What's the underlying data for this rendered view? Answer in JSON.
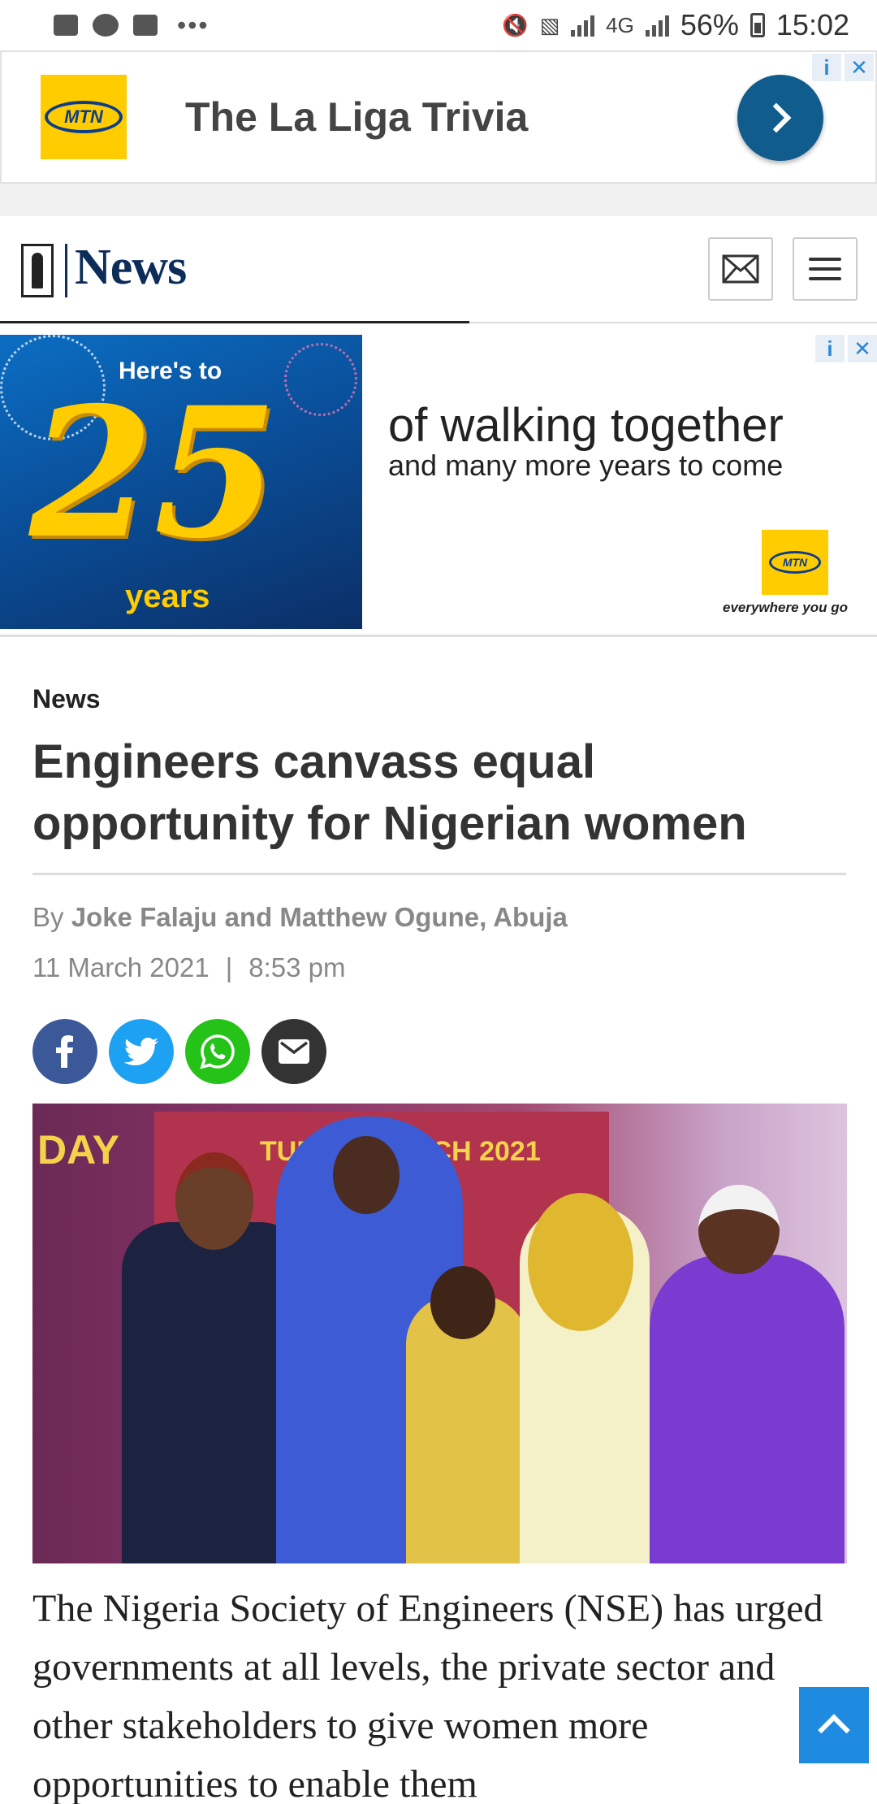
{
  "status_bar": {
    "battery": "56%",
    "time": "15:02",
    "network": "4G"
  },
  "top_ad": {
    "brand": "MTN",
    "title": "The La Liga Trivia"
  },
  "header": {
    "logo_text": "News"
  },
  "banner_ad": {
    "heres_to": "Here's to",
    "number": "25",
    "years": "years",
    "line1": "of walking together",
    "line2": "and many more years to come",
    "brand": "MTN",
    "tagline": "everywhere you go"
  },
  "article": {
    "category": "News",
    "headline": "Engineers canvass equal opportunity for Nigerian women",
    "by_prefix": "By",
    "authors": "Joke Falaju and Matthew Ogune, Abuja",
    "date": "11 March 2021",
    "separator": "|",
    "time": "8:53 pm",
    "photo_banner_text": "TUES    H MARCH 2021",
    "photo_day_text": "DAY",
    "body": "The Nigeria Society of Engineers (NSE) has urged governments at all levels, the private sector and other stakeholders to give women more opportunities to enable them"
  },
  "share": {
    "facebook": "f",
    "twitter": "t",
    "whatsapp": "w",
    "email": "e"
  },
  "colors": {
    "brand_navy": "#0c2d5a",
    "mtn_yellow": "#ffcc00",
    "back_to_top": "#1e8be0"
  }
}
